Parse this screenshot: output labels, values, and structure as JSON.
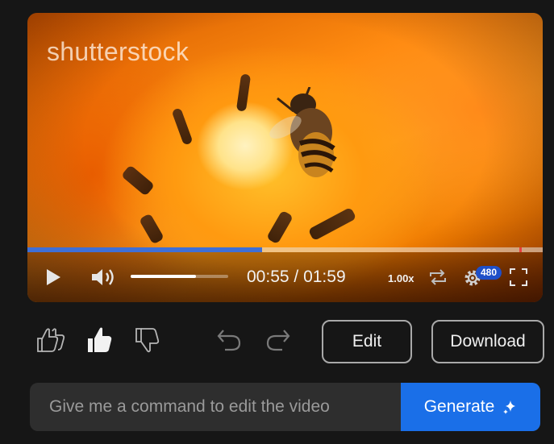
{
  "video": {
    "watermark": "shutterstock",
    "progress_fraction": 0.456,
    "current_time": "00:55",
    "time_separator": " / ",
    "duration": "01:59",
    "playback_speed": "1.00x",
    "quality": "480",
    "volume_fraction": 0.67,
    "icons": {
      "play": "play-icon",
      "volume": "volume-icon",
      "loop": "loop-icon",
      "settings": "gear-icon",
      "fullscreen": "fullscreen-icon"
    }
  },
  "actions": {
    "icons": [
      "thumbs-up-double-icon",
      "thumbs-up-icon",
      "thumbs-down-icon",
      "undo-icon",
      "redo-icon"
    ],
    "edit_label": "Edit",
    "download_label": "Download"
  },
  "command": {
    "placeholder": "Give me a command to edit the video",
    "generate_label": "Generate",
    "generate_icon": "sparkle-icon"
  },
  "colors": {
    "progress": "#3f6fd6",
    "quality_badge": "#1e4fc8",
    "generate_button": "#1a6fe8",
    "background": "#161616"
  }
}
